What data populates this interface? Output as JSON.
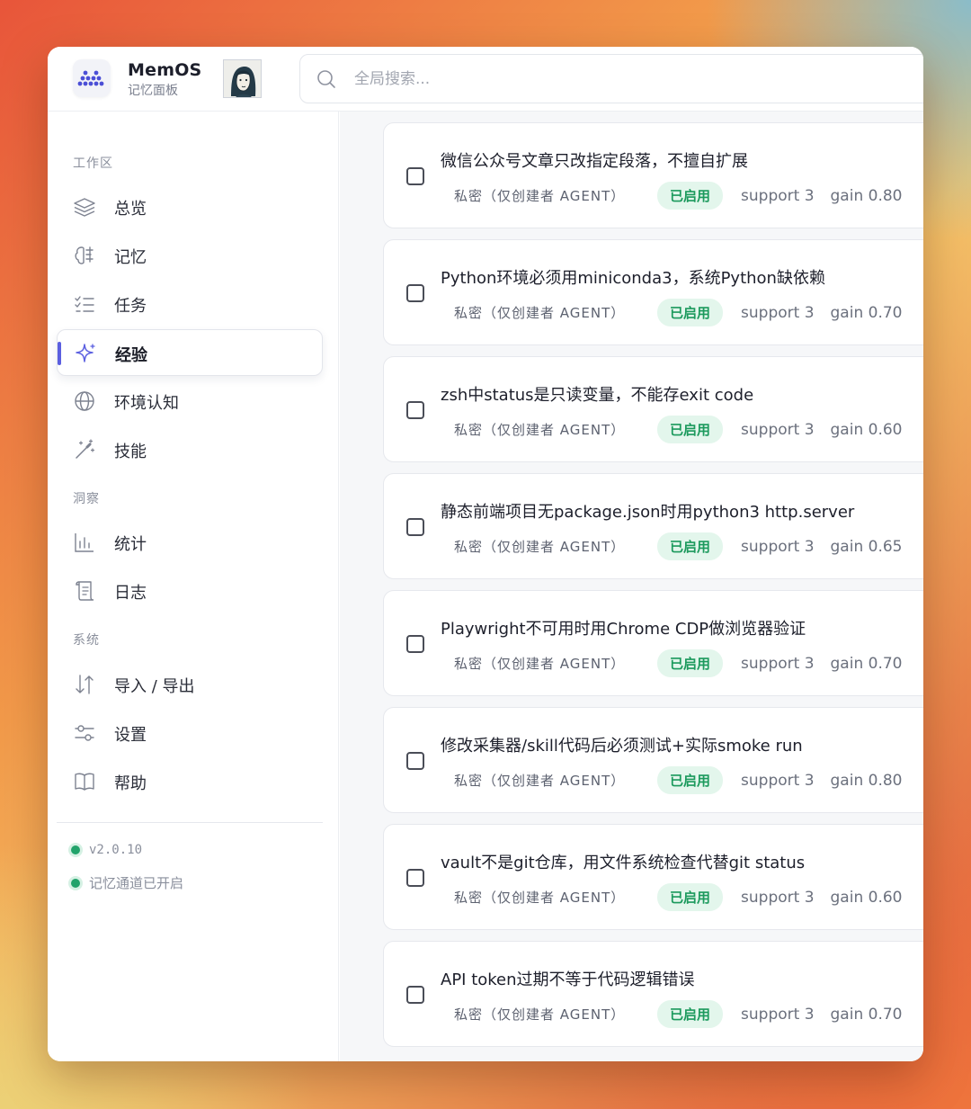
{
  "brand": {
    "name": "MemOS",
    "subtitle": "记忆面板"
  },
  "search": {
    "placeholder": "全局搜索..."
  },
  "sidebar": {
    "sections": [
      {
        "title": "工作区"
      },
      {
        "title": "洞察"
      },
      {
        "title": "系统"
      }
    ],
    "items": [
      {
        "label": "总览",
        "icon": "layers-icon"
      },
      {
        "label": "记忆",
        "icon": "brain-icon"
      },
      {
        "label": "任务",
        "icon": "checklist-icon"
      },
      {
        "label": "经验",
        "icon": "sparkle-icon",
        "active": true
      },
      {
        "label": "环境认知",
        "icon": "globe-icon"
      },
      {
        "label": "技能",
        "icon": "magic-wand-icon"
      },
      {
        "label": "统计",
        "icon": "bar-chart-icon"
      },
      {
        "label": "日志",
        "icon": "scroll-icon"
      },
      {
        "label": "导入 / 导出",
        "icon": "arrows-up-down-icon"
      },
      {
        "label": "设置",
        "icon": "sliders-icon"
      },
      {
        "label": "帮助",
        "icon": "book-icon"
      }
    ],
    "version": "v2.0.10",
    "channel_status": "记忆通道已开启"
  },
  "experiences": [
    {
      "title": "微信公众号文章只改指定段落，不擅自扩展",
      "scope": "私密（仅创建者 AGENT）",
      "status": "已启用",
      "support": "support 3",
      "gain": "gain 0.80"
    },
    {
      "title": "Python环境必须用miniconda3，系统Python缺依赖",
      "scope": "私密（仅创建者 AGENT）",
      "status": "已启用",
      "support": "support 3",
      "gain": "gain 0.70"
    },
    {
      "title": "zsh中status是只读变量，不能存exit code",
      "scope": "私密（仅创建者 AGENT）",
      "status": "已启用",
      "support": "support 3",
      "gain": "gain 0.60"
    },
    {
      "title": "静态前端项目无package.json时用python3 http.server",
      "scope": "私密（仅创建者 AGENT）",
      "status": "已启用",
      "support": "support 3",
      "gain": "gain 0.65"
    },
    {
      "title": "Playwright不可用时用Chrome CDP做浏览器验证",
      "scope": "私密（仅创建者 AGENT）",
      "status": "已启用",
      "support": "support 3",
      "gain": "gain 0.70"
    },
    {
      "title": "修改采集器/skill代码后必须测试+实际smoke run",
      "scope": "私密（仅创建者 AGENT）",
      "status": "已启用",
      "support": "support 3",
      "gain": "gain 0.80"
    },
    {
      "title": "vault不是git仓库，用文件系统检查代替git status",
      "scope": "私密（仅创建者 AGENT）",
      "status": "已启用",
      "support": "support 3",
      "gain": "gain 0.60"
    },
    {
      "title": "API token过期不等于代码逻辑错误",
      "scope": "私密（仅创建者 AGENT）",
      "status": "已启用",
      "support": "support 3",
      "gain": "gain 0.70"
    }
  ],
  "colors": {
    "accent": "#5b5fe0",
    "enabled_green": "#1c9a5d",
    "enabled_bg": "#e3f6ec",
    "status_dot": "#22a36b"
  }
}
